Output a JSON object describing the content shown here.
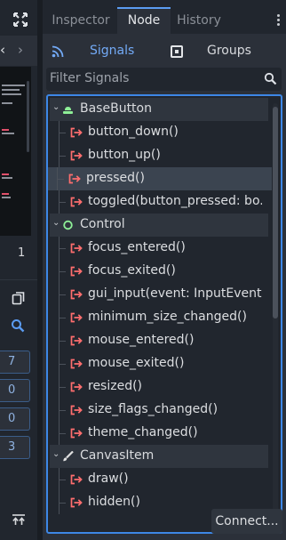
{
  "left_panel": {
    "line_number": "1",
    "fields": [
      "7",
      "0",
      "0",
      "3"
    ]
  },
  "tabs": [
    {
      "label": "Inspector",
      "active": false
    },
    {
      "label": "Node",
      "active": true
    },
    {
      "label": "History",
      "active": false
    }
  ],
  "modes": {
    "signals_label": "Signals",
    "groups_label": "Groups"
  },
  "filter": {
    "placeholder": "Filter Signals"
  },
  "signal_tree": [
    {
      "type": "category",
      "label": "BaseButton",
      "icon": "base-button-icon",
      "icon_color": "#8eef97"
    },
    {
      "type": "signal",
      "label": "button_down()"
    },
    {
      "type": "signal",
      "label": "button_up()"
    },
    {
      "type": "signal",
      "label": "pressed()",
      "selected": true
    },
    {
      "type": "signal",
      "label": "toggled(button_pressed: bo..."
    },
    {
      "type": "category",
      "label": "Control",
      "icon": "control-icon",
      "icon_color": "#8eef97"
    },
    {
      "type": "signal",
      "label": "focus_entered()"
    },
    {
      "type": "signal",
      "label": "focus_exited()"
    },
    {
      "type": "signal",
      "label": "gui_input(event: InputEvent)"
    },
    {
      "type": "signal",
      "label": "minimum_size_changed()"
    },
    {
      "type": "signal",
      "label": "mouse_entered()"
    },
    {
      "type": "signal",
      "label": "mouse_exited()"
    },
    {
      "type": "signal",
      "label": "resized()"
    },
    {
      "type": "signal",
      "label": "size_flags_changed()"
    },
    {
      "type": "signal",
      "label": "theme_changed()"
    },
    {
      "type": "category",
      "label": "CanvasItem",
      "icon": "canvas-item-icon",
      "icon_color": "#e0e0e0"
    },
    {
      "type": "signal",
      "label": "draw()"
    },
    {
      "type": "signal",
      "label": "hidden()"
    }
  ],
  "connect_button": "Connect...",
  "colors": {
    "accent": "#5b9cf2",
    "signal_icon": "#ff6e6e",
    "control_green": "#8eef97"
  }
}
